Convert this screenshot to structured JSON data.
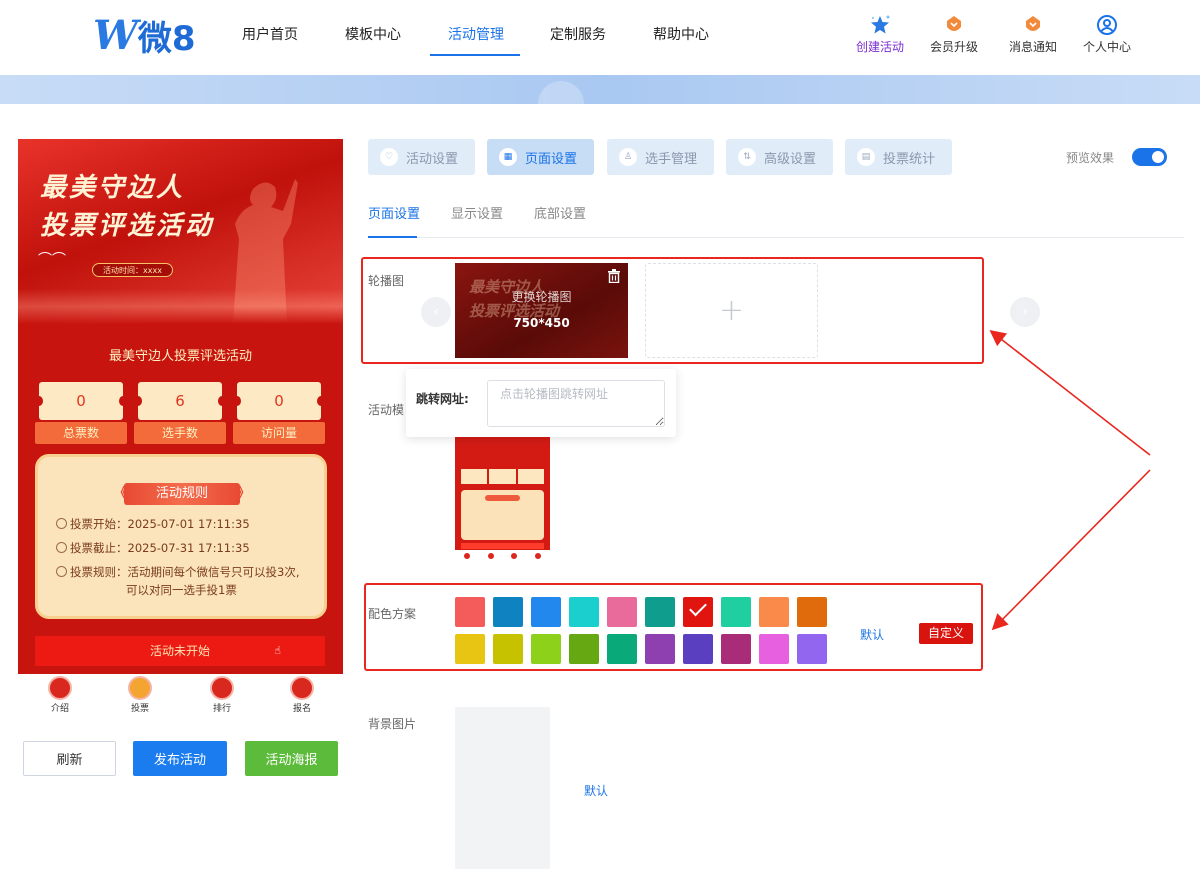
{
  "nav": {
    "logo_mark": "W",
    "logo_text": "微8",
    "items": [
      "用户首页",
      "模板中心",
      "活动管理",
      "定制服务",
      "帮助中心"
    ],
    "right": [
      {
        "label": "创建活动",
        "icon": "star-icon"
      },
      {
        "label": "会员升级",
        "icon": "medal-icon"
      },
      {
        "label": "消息通知",
        "icon": "bell-icon"
      },
      {
        "label": "个人中心",
        "icon": "user-icon"
      }
    ]
  },
  "preview": {
    "poster_line1": "最美守边人",
    "poster_line2": "投票评选活动",
    "poster_time": "活动时间：xxxx",
    "title": "最美守边人投票评选活动",
    "stats": [
      {
        "value": "0",
        "label": "总票数"
      },
      {
        "value": "6",
        "label": "选手数"
      },
      {
        "value": "0",
        "label": "访问量"
      }
    ],
    "rules_title": "活动规则",
    "rule_start": "投票开始：2025-07-01 17:11:35",
    "rule_end": "投票截止：2025-07-31 17:11:35",
    "rule_desc_1": "投票规则：活动期间每个微信号只可以投3次,",
    "rule_desc_2": "可以对同一选手投1票",
    "status_button": "活动未开始",
    "tabbar": [
      "介绍",
      "投票",
      "排行",
      "报名"
    ]
  },
  "actions": {
    "refresh": "刷新",
    "publish": "发布活动",
    "poster": "活动海报"
  },
  "settings_tabs": [
    "活动设置",
    "页面设置",
    "选手管理",
    "高级设置",
    "投票统计"
  ],
  "preview_toggle_label": "预览效果",
  "sub_tabs": [
    "页面设置",
    "显示设置",
    "底部设置"
  ],
  "fields": {
    "carousel": "轮播图",
    "template": "活动模",
    "color_scheme": "配色方案",
    "bg_image": "背景图片"
  },
  "carousel": {
    "change_label": "更换轮播图",
    "size_label": "750*450",
    "thumb_ghost_1": "最美守边人",
    "thumb_ghost_2": "投票评选活动",
    "add_symbol": "+"
  },
  "jump": {
    "label": "跳转网址:",
    "placeholder": "点击轮播图跳转网址"
  },
  "colors": {
    "row1": [
      "#f45b5b",
      "#0f83c2",
      "#2288ee",
      "#1ccfcf",
      "#e96b9c",
      "#0f9e8e",
      "#e0150f",
      "#1fcf9f",
      "#fa8a4a",
      "#e06b0c"
    ],
    "row2": [
      "#e8c413",
      "#c6c200",
      "#8ed11a",
      "#66a812",
      "#0aa97a",
      "#8e3fb0",
      "#5a3fc0",
      "#a82c78",
      "#e660e0",
      "#9266ee"
    ],
    "selected": "#e0150f",
    "default_label": "默认",
    "custom_label": "自定义"
  },
  "bg": {
    "default_label": "默认"
  },
  "accent": "#1a73e8",
  "highlight": "#e9271f"
}
